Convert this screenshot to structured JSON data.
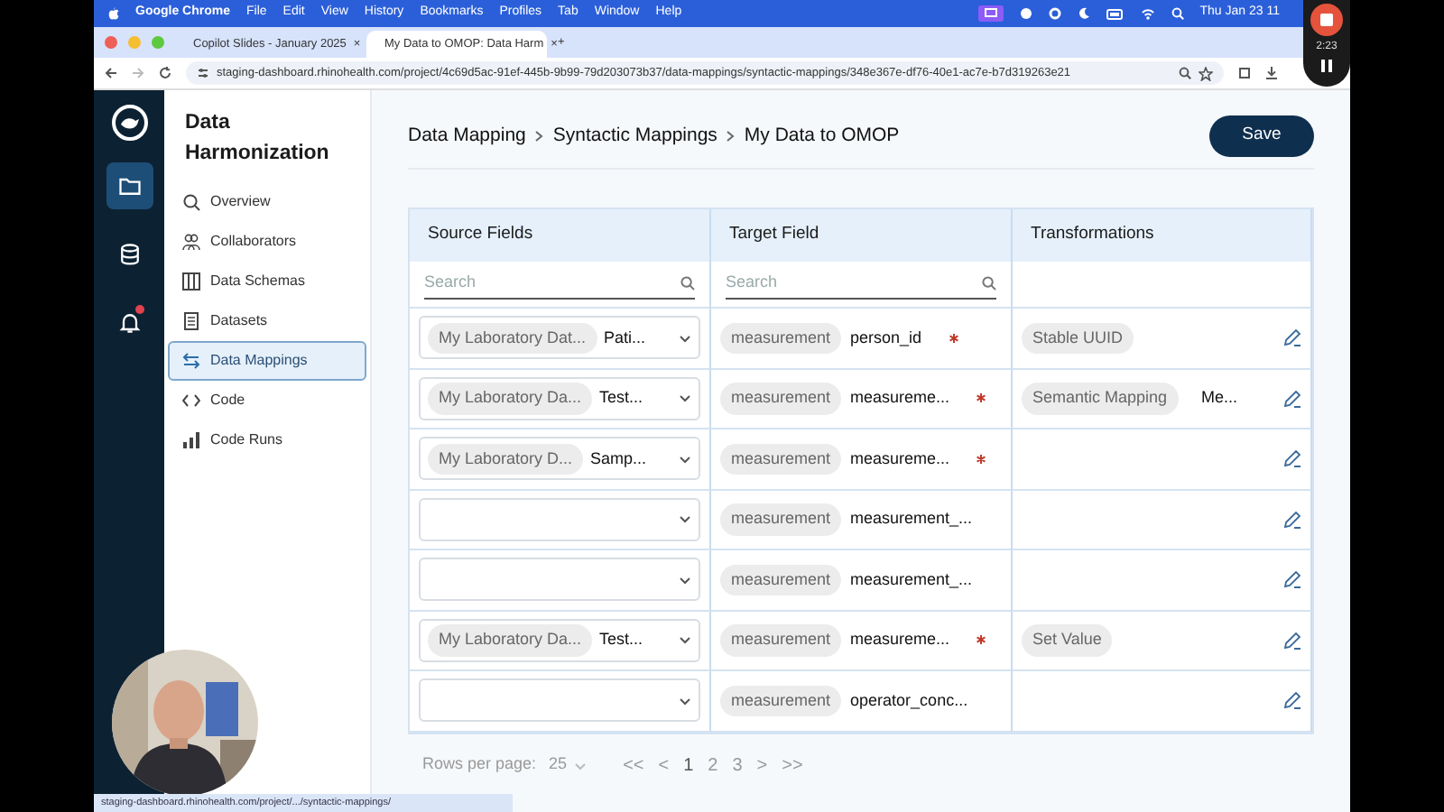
{
  "menu_bar": {
    "app": "Google Chrome",
    "items": [
      "File",
      "Edit",
      "View",
      "History",
      "Bookmarks",
      "Profiles",
      "Tab",
      "Window",
      "Help"
    ],
    "clock": "Thu Jan 23 11"
  },
  "recorder": {
    "time": "2:23"
  },
  "browser": {
    "tabs": [
      {
        "title": "Copilot Slides - January 2025",
        "close": "×",
        "selected": false
      },
      {
        "title": "My Data to OMOP: Data Harm",
        "close": "×",
        "selected": true
      }
    ],
    "new_tab": "+",
    "address": "staging-dashboard.rhinohealth.com/project/4c69d5ac-91ef-445b-9b99-79d203073b37/data-mappings/syntactic-mappings/348e367e-df76-40e1-ac7e-b7d319263e21"
  },
  "rail": [
    {
      "kind": "folder",
      "selected": true,
      "alert": false
    },
    {
      "kind": "database",
      "selected": false,
      "alert": false
    },
    {
      "kind": "bell",
      "selected": false,
      "alert": true
    }
  ],
  "sidebar": {
    "title": "Data Harmonization",
    "items": [
      {
        "label": "Overview",
        "kind": "search",
        "selected": false
      },
      {
        "label": "Collaborators",
        "kind": "people",
        "selected": false
      },
      {
        "label": "Data Schemas",
        "kind": "columns",
        "selected": false
      },
      {
        "label": "Datasets",
        "kind": "document",
        "selected": false
      },
      {
        "label": "Data Mappings",
        "kind": "arrows",
        "selected": true
      },
      {
        "label": "Code",
        "kind": "code",
        "selected": false
      },
      {
        "label": "Code Runs",
        "kind": "bars",
        "selected": false
      }
    ]
  },
  "breadcrumb": [
    "Data Mapping",
    "Syntactic Mappings",
    "My Data to OMOP"
  ],
  "save_button": "Save",
  "table": {
    "columns": [
      "Source Fields",
      "Target Field",
      "Transformations"
    ],
    "search_placeholders": [
      "Search",
      "Search"
    ],
    "rows": [
      {
        "source": {
          "dataset": "My Laboratory Dat...",
          "field": "Pati..."
        },
        "target": {
          "table": "measurement",
          "field": "person_id",
          "required": true
        },
        "transform": {
          "chip": "Stable UUID"
        }
      },
      {
        "source": {
          "dataset": "My Laboratory Da...",
          "field": "Test..."
        },
        "target": {
          "table": "measurement",
          "field": "measureme...",
          "required": true
        },
        "transform": {
          "chip": "Semantic Mapping",
          "extra": "Me..."
        }
      },
      {
        "source": {
          "dataset": "My Laboratory D...",
          "field": "Samp..."
        },
        "target": {
          "table": "measurement",
          "field": "measureme...",
          "required": true
        }
      },
      {
        "target": {
          "table": "measurement",
          "field": "measurement_...",
          "required": false
        }
      },
      {
        "target": {
          "table": "measurement",
          "field": "measurement_...",
          "required": false
        }
      },
      {
        "source": {
          "dataset": "My Laboratory Da...",
          "field": "Test..."
        },
        "target": {
          "table": "measurement",
          "field": "measureme...",
          "required": true
        },
        "transform": {
          "chip": "Set Value"
        }
      },
      {
        "target": {
          "table": "measurement",
          "field": "operator_conc...",
          "required": false
        }
      }
    ]
  },
  "pagination": {
    "label": "Rows per page:",
    "rows_per_page": "25",
    "first": "<<",
    "prev": "<",
    "pages": [
      {
        "label": "1",
        "selected": true
      },
      {
        "label": "2",
        "selected": false
      },
      {
        "label": "3",
        "selected": false
      }
    ],
    "next": ">",
    "last": ">>"
  },
  "status_url": "staging-dashboard.rhinohealth.com/project/.../syntactic-mappings/"
}
